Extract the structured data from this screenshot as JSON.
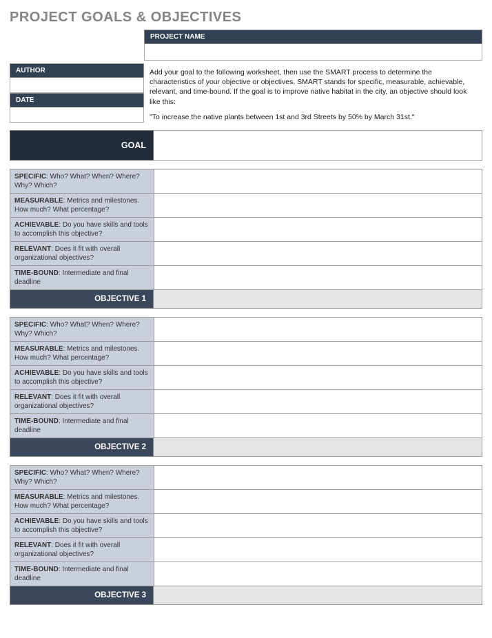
{
  "title": "PROJECT GOALS & OBJECTIVES",
  "labels": {
    "project_name": "PROJECT NAME",
    "author": "AUTHOR",
    "date": "DATE",
    "goal": "GOAL"
  },
  "instructions": {
    "body": "Add your goal to the following worksheet, then use the SMART process to determine the characteristics of your objective or objectives. SMART stands for specific, measurable, achievable, relevant, and time-bound. If the goal is to improve native habitat in the city, an objective should look like this:",
    "example": "\"To increase the native plants between 1st and 3rd Streets by 50% by March 31st.\""
  },
  "values": {
    "project_name": "",
    "author": "",
    "date": "",
    "goal": ""
  },
  "criteria": [
    {
      "term": "SPECIFIC",
      "prompt": ": Who? What? When? Where? Why? Which?"
    },
    {
      "term": "MEASURABLE",
      "prompt": ": Metrics and milestones. How much? What percentage?"
    },
    {
      "term": "ACHIEVABLE",
      "prompt": ": Do you have skills and tools to accomplish this objective?"
    },
    {
      "term": "RELEVANT",
      "prompt": ": Does it fit with overall organizational objectives?"
    },
    {
      "term": "TIME-BOUND",
      "prompt": ": Intermediate and final deadline"
    }
  ],
  "objectives": [
    {
      "label": "OBJECTIVE 1",
      "values": [
        "",
        "",
        "",
        "",
        ""
      ]
    },
    {
      "label": "OBJECTIVE 2",
      "values": [
        "",
        "",
        "",
        "",
        ""
      ]
    },
    {
      "label": "OBJECTIVE 3",
      "values": [
        "",
        "",
        "",
        "",
        ""
      ]
    }
  ]
}
